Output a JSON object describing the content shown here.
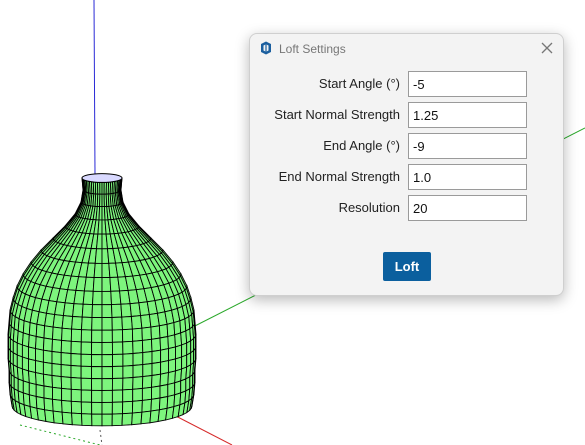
{
  "dialog": {
    "title": "Loft Settings",
    "app_icon": "sketchup-logo-icon",
    "close_icon": "close-icon",
    "fields": [
      {
        "label": "Start Angle (°)",
        "value": "-5"
      },
      {
        "label": "Start Normal Strength",
        "value": "1.25"
      },
      {
        "label": "End Angle (°)",
        "value": "-9"
      },
      {
        "label": "End Normal Strength",
        "value": "1.0"
      },
      {
        "label": "Resolution",
        "value": "20"
      }
    ],
    "loft_label": "Loft"
  },
  "colors": {
    "accent_button": "#0b5f9e",
    "mesh_fill": "#7df57d",
    "axis_blue": "#2a2ad6",
    "axis_green": "#2aa82a",
    "axis_red": "#d62a2a"
  }
}
